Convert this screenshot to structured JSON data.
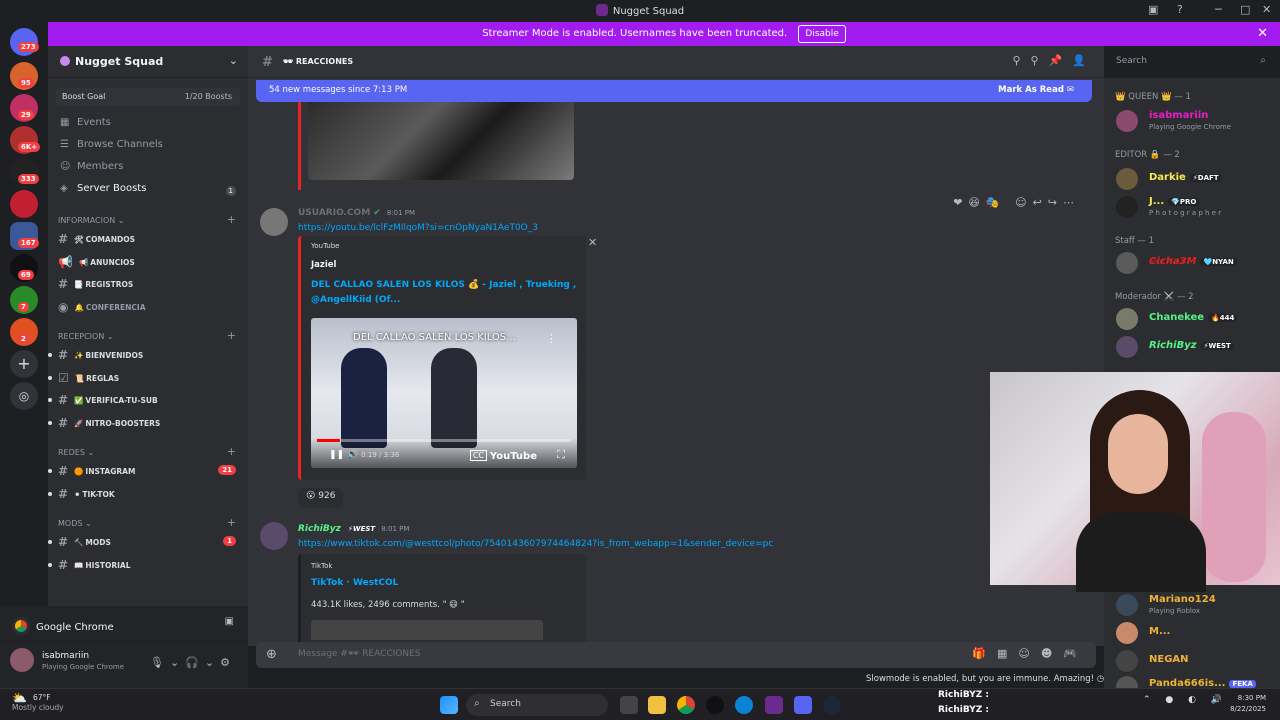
{
  "window": {
    "title": "Nugget Squad"
  },
  "banner": {
    "text": "Streamer Mode is enabled. Usernames have been truncated.",
    "disable_label": "Disable"
  },
  "servers": [
    {
      "badge": "273",
      "color": "#5865f2"
    },
    {
      "badge": "95",
      "color": "#d9642b"
    },
    {
      "badge": "29",
      "color": "#c03060"
    },
    {
      "badge": "6K+",
      "color": "#b03030"
    },
    {
      "badge": "333",
      "color": "#222222"
    },
    {
      "badge": "",
      "color": "#c02030"
    },
    {
      "badge": "167",
      "color": "#3b5998"
    },
    {
      "badge": "69",
      "color": "#111111"
    },
    {
      "badge": "7",
      "color": "#2a8a2a"
    },
    {
      "badge": "2",
      "color": "#e05020"
    }
  ],
  "guild": {
    "name": "Nugget Squad"
  },
  "boost": {
    "label": "Boost Goal",
    "value": "1/20 Boosts"
  },
  "nav": [
    {
      "label": "Events",
      "icon": "calendar-icon"
    },
    {
      "label": "Browse Channels",
      "icon": "browse-icon"
    },
    {
      "label": "Members",
      "icon": "members-icon"
    },
    {
      "label": "Server Boosts",
      "icon": "boost-icon",
      "count": "1"
    }
  ],
  "categories": [
    {
      "name": "INFORMACION",
      "channels": [
        {
          "emoji": "🛠",
          "name": "COMANDOS"
        },
        {
          "emoji": "📢",
          "name": "ANUNCIOS"
        },
        {
          "emoji": "📑",
          "name": "REGISTROS"
        },
        {
          "emoji": "🔔",
          "name": "CONFERENCIA"
        }
      ]
    },
    {
      "name": "RECEPCION",
      "channels": [
        {
          "emoji": "✨",
          "name": "BIENVENIDOS"
        },
        {
          "emoji": "📜",
          "name": "REGLAS"
        },
        {
          "emoji": "✅",
          "name": "VERIFICA-TU-SUB"
        },
        {
          "emoji": "🚀",
          "name": "NITRO-BOOSTERS"
        }
      ]
    },
    {
      "name": "REDES",
      "channels": [
        {
          "emoji": "🟠",
          "name": "INSTAGRAM",
          "count": "21"
        },
        {
          "emoji": "⚫",
          "name": "TIK-TOK"
        }
      ]
    },
    {
      "name": "MODS",
      "channels": [
        {
          "emoji": "🔨",
          "name": "MODS",
          "count": "1"
        },
        {
          "emoji": "📖",
          "name": "HISTORIAL"
        }
      ]
    }
  ],
  "user_panel": {
    "activity": "Google Chrome",
    "username": "isabmariin",
    "status": "Playing Google Chrome"
  },
  "channel_header": {
    "name": "REACCIONES",
    "search_placeholder": "Search"
  },
  "new_messages": {
    "text": "54 new messages since 7:13 PM",
    "action": "Mark As Read"
  },
  "messages": [
    {
      "author": "USUARIO.COM",
      "time": "8:01 PM",
      "link": "https://youtu.be/lclFzMIlqoM?si=cnOpNyaN1AeT0O_3",
      "embed": {
        "provider": "YouTube",
        "author": "Jaziel",
        "title": "DEL CALLAO SALEN LOS KILOS 💰 - Jaziel , Trueking , @AngellKiid (Of...",
        "video_title": "DEL CALLAO SALEN LOS KILOS...",
        "time": "0:19 / 3:36",
        "progress": 0.09,
        "yt_label": "YouTube"
      },
      "reaction": {
        "emoji": "😮",
        "count": "926"
      }
    },
    {
      "author": "RichiByz",
      "tag": "WEST",
      "time": "8:01 PM",
      "link": "https://www.tiktok.com/@westtcol/photo/7540143607974464824?is_from_webapp=1&sender_device=pc",
      "embed": {
        "provider": "TikTok",
        "title": "TikTok · WestCOL",
        "desc": "443.1K likes, 2496 comments. \" 😄 \""
      }
    }
  ],
  "composer": {
    "placeholder": "Message #🕶 REACCIONES"
  },
  "slowmode": "Slowmode is enabled, but you are immune. Amazing!",
  "members": {
    "groups": [
      {
        "title": "👑 QUEEN 👑 — 1",
        "members": [
          {
            "name": "isabmariin",
            "status": "Playing Google Chrome",
            "color": "#e91ec7"
          }
        ]
      },
      {
        "title": "EDITOR 🔒 — 2",
        "members": [
          {
            "name": "Darkie",
            "tag": "DAFT",
            "color": "#fce94f"
          },
          {
            "name": "J...",
            "tag": "PRO",
            "status": "P h o t o g r a p h e r",
            "color": "#fce94f"
          }
        ]
      },
      {
        "title": "Staff — 1",
        "members": [
          {
            "name": "C̷i̷c̷h̷a̷3̷M",
            "tag": "NYAN",
            "color": "#e02020"
          }
        ]
      },
      {
        "title": "Moderador ⚔️ — 2",
        "members": [
          {
            "name": "Chanekee",
            "tag": "444",
            "color": "#57f287"
          },
          {
            "name": "RichiByz",
            "tag": "WEST",
            "color": "#57f287"
          }
        ]
      }
    ],
    "lower": [
      {
        "name": "Mariano124",
        "status": "Playing Roblox",
        "color": "#f0b232"
      },
      {
        "name": "M...",
        "color": "#f0b232"
      },
      {
        "name": "NEGAN",
        "color": "#f0b232"
      },
      {
        "name": "Panda666is...",
        "tag": "FEKA",
        "color": "#f0b232"
      }
    ]
  },
  "overlay": [
    "RichiBYZ :",
    "RichiBYZ :"
  ],
  "taskbar": {
    "weather_temp": "67°F",
    "weather_desc": "Mostly cloudy",
    "search": "Search",
    "time": "8:30 PM",
    "date": "8/22/2025"
  }
}
